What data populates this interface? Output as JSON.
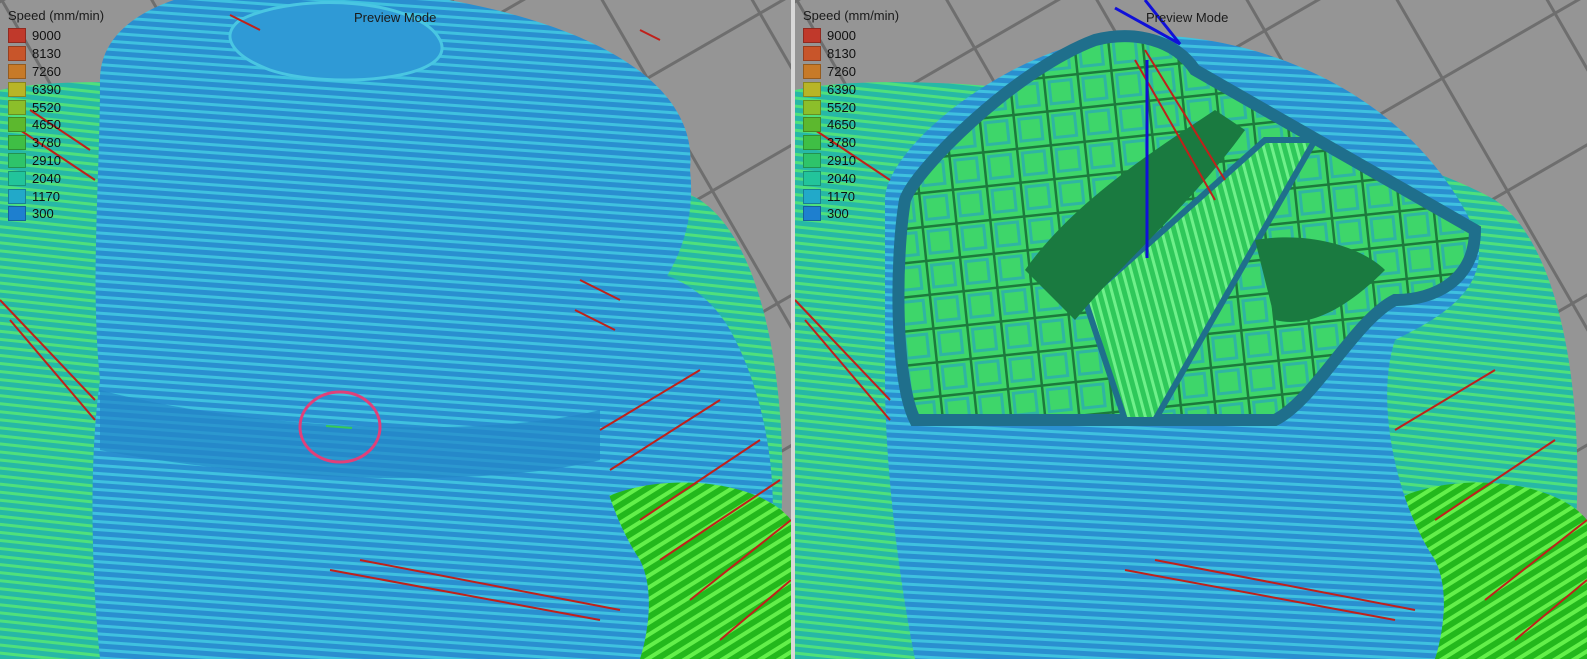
{
  "legend": {
    "title": "Speed (mm/min)",
    "entries": [
      {
        "value": "9000",
        "color": "#c0392b"
      },
      {
        "value": "8130",
        "color": "#c8552a"
      },
      {
        "value": "7260",
        "color": "#c77a28"
      },
      {
        "value": "6390",
        "color": "#b8b526"
      },
      {
        "value": "5520",
        "color": "#8cbf2a"
      },
      {
        "value": "4650",
        "color": "#5cb82e"
      },
      {
        "value": "3780",
        "color": "#3fbf45"
      },
      {
        "value": "2910",
        "color": "#2ec46a"
      },
      {
        "value": "2040",
        "color": "#22c49b"
      },
      {
        "value": "1170",
        "color": "#22a9c9"
      },
      {
        "value": "300",
        "color": "#1e7fcf"
      }
    ]
  },
  "left_view": {
    "mode_label": "Preview Mode"
  },
  "right_view": {
    "mode_label": "Preview Mode"
  },
  "colors": {
    "background": "#939393",
    "perimeter_blue": "#2a8fd0",
    "infill_green": "#34d23c",
    "travel_red": "#c0201a",
    "highlight_circle": "#e0407a",
    "toolpath_blue": "#1010d8"
  }
}
